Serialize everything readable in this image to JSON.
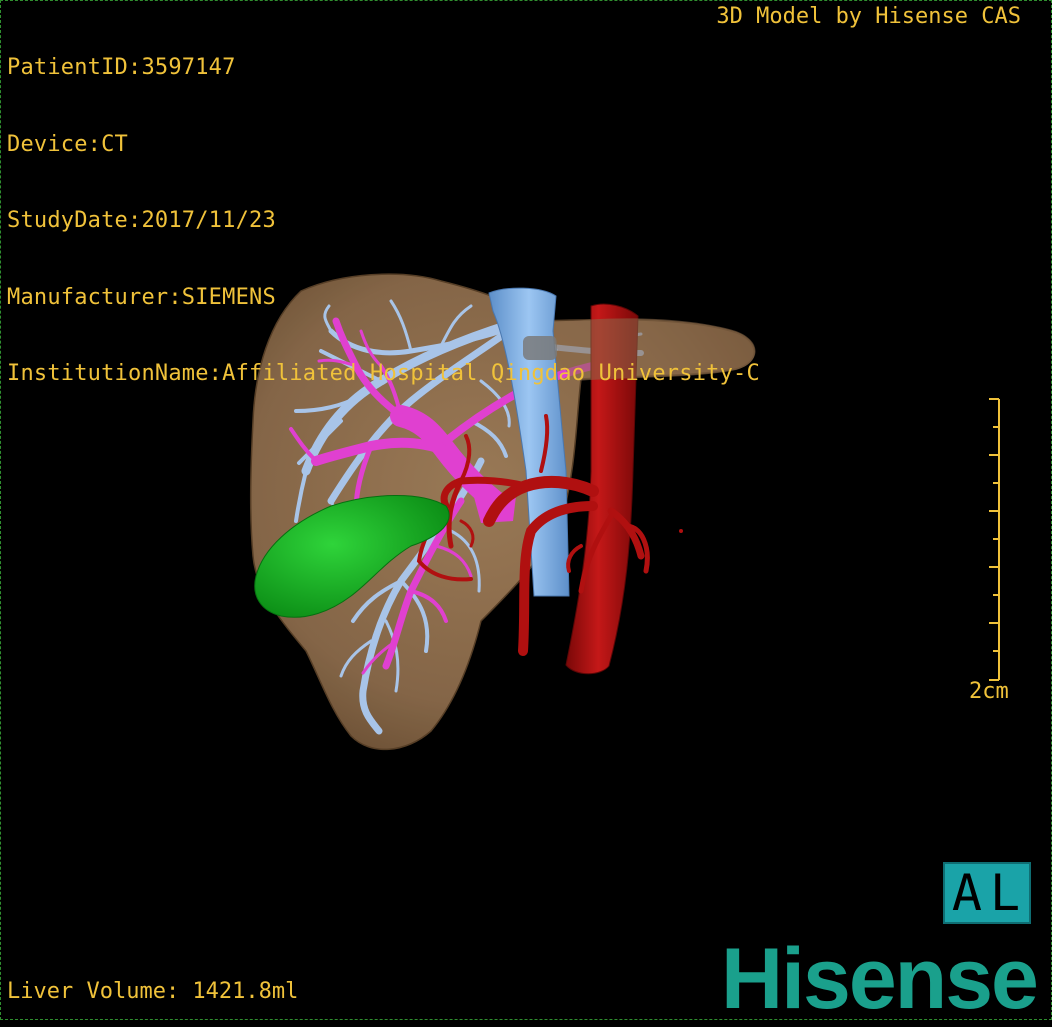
{
  "overlay": {
    "patient_id": "PatientID:3597147",
    "device": "Device:CT",
    "study_date": "StudyDate:2017/11/23",
    "manufacturer": "Manufacturer:SIEMENS",
    "institution": "InstitutionName:Affiliated Hospital Qingdao University-C",
    "watermark": "3D Model by Hisense CAS",
    "liver_volume": "Liver Volume: 1421.8ml"
  },
  "scale": {
    "label": "2cm"
  },
  "orientation": {
    "label": "AL"
  },
  "brand": {
    "logo": "Hisense"
  },
  "colors": {
    "overlay_text": "#f0c23a",
    "liver": "#8a6a4a",
    "portal_vein": "#e040d0",
    "hepatic_vein": "#a8c4e8",
    "ivc": "#7fb3ec",
    "artery": "#b01010",
    "gallbladder": "#12b022",
    "logo": "#1aa08c",
    "orientation_box": "#1aa3a8",
    "border": "#2f8f2f"
  },
  "model": {
    "structures": [
      "liver",
      "hepatic-veins",
      "portal-vein",
      "inferior-vena-cava",
      "aorta-and-arteries",
      "gallbladder"
    ]
  }
}
